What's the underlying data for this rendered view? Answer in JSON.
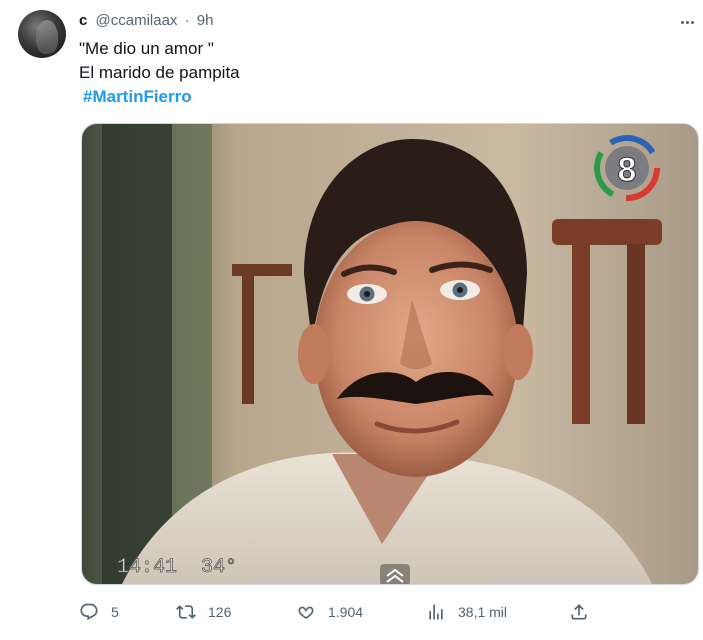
{
  "author": {
    "display_name": "c",
    "handle": "@ccamilaax",
    "separator": "·",
    "time": "9h"
  },
  "tweet": {
    "lines": [
      "\"Me dio un amor \"",
      "El marido de pampita"
    ],
    "hashtag": "#MartinFierro"
  },
  "media": {
    "channel_badge": "8",
    "timestamp_overlay": "14:41  34°"
  },
  "actions": {
    "replies": "5",
    "retweets": "126",
    "likes": "1.904",
    "views": "38,1 mil"
  },
  "colors": {
    "accent": "#1d9bf0",
    "text_primary": "#0f1419",
    "text_secondary": "#536471"
  },
  "icons": [
    "more-icon",
    "reply-icon",
    "retweet-icon",
    "like-icon",
    "views-icon",
    "share-icon",
    "channel-8-logo"
  ]
}
